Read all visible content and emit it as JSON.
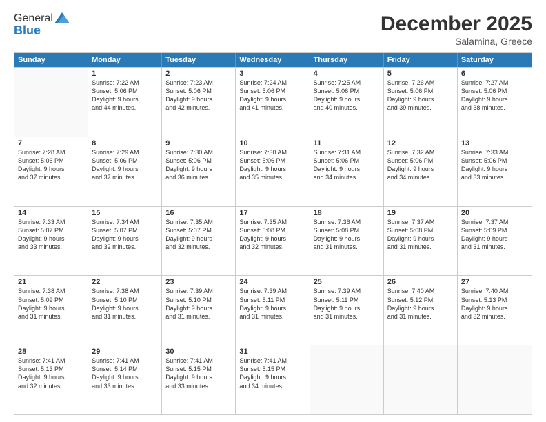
{
  "header": {
    "logo_general": "General",
    "logo_blue": "Blue",
    "month_title": "December 2025",
    "location": "Salamina, Greece"
  },
  "days_of_week": [
    "Sunday",
    "Monday",
    "Tuesday",
    "Wednesday",
    "Thursday",
    "Friday",
    "Saturday"
  ],
  "weeks": [
    [
      {
        "day": "",
        "lines": []
      },
      {
        "day": "1",
        "lines": [
          "Sunrise: 7:22 AM",
          "Sunset: 5:06 PM",
          "Daylight: 9 hours",
          "and 44 minutes."
        ]
      },
      {
        "day": "2",
        "lines": [
          "Sunrise: 7:23 AM",
          "Sunset: 5:06 PM",
          "Daylight: 9 hours",
          "and 42 minutes."
        ]
      },
      {
        "day": "3",
        "lines": [
          "Sunrise: 7:24 AM",
          "Sunset: 5:06 PM",
          "Daylight: 9 hours",
          "and 41 minutes."
        ]
      },
      {
        "day": "4",
        "lines": [
          "Sunrise: 7:25 AM",
          "Sunset: 5:06 PM",
          "Daylight: 9 hours",
          "and 40 minutes."
        ]
      },
      {
        "day": "5",
        "lines": [
          "Sunrise: 7:26 AM",
          "Sunset: 5:06 PM",
          "Daylight: 9 hours",
          "and 39 minutes."
        ]
      },
      {
        "day": "6",
        "lines": [
          "Sunrise: 7:27 AM",
          "Sunset: 5:06 PM",
          "Daylight: 9 hours",
          "and 38 minutes."
        ]
      }
    ],
    [
      {
        "day": "7",
        "lines": [
          "Sunrise: 7:28 AM",
          "Sunset: 5:06 PM",
          "Daylight: 9 hours",
          "and 37 minutes."
        ]
      },
      {
        "day": "8",
        "lines": [
          "Sunrise: 7:29 AM",
          "Sunset: 5:06 PM",
          "Daylight: 9 hours",
          "and 37 minutes."
        ]
      },
      {
        "day": "9",
        "lines": [
          "Sunrise: 7:30 AM",
          "Sunset: 5:06 PM",
          "Daylight: 9 hours",
          "and 36 minutes."
        ]
      },
      {
        "day": "10",
        "lines": [
          "Sunrise: 7:30 AM",
          "Sunset: 5:06 PM",
          "Daylight: 9 hours",
          "and 35 minutes."
        ]
      },
      {
        "day": "11",
        "lines": [
          "Sunrise: 7:31 AM",
          "Sunset: 5:06 PM",
          "Daylight: 9 hours",
          "and 34 minutes."
        ]
      },
      {
        "day": "12",
        "lines": [
          "Sunrise: 7:32 AM",
          "Sunset: 5:06 PM",
          "Daylight: 9 hours",
          "and 34 minutes."
        ]
      },
      {
        "day": "13",
        "lines": [
          "Sunrise: 7:33 AM",
          "Sunset: 5:06 PM",
          "Daylight: 9 hours",
          "and 33 minutes."
        ]
      }
    ],
    [
      {
        "day": "14",
        "lines": [
          "Sunrise: 7:33 AM",
          "Sunset: 5:07 PM",
          "Daylight: 9 hours",
          "and 33 minutes."
        ]
      },
      {
        "day": "15",
        "lines": [
          "Sunrise: 7:34 AM",
          "Sunset: 5:07 PM",
          "Daylight: 9 hours",
          "and 32 minutes."
        ]
      },
      {
        "day": "16",
        "lines": [
          "Sunrise: 7:35 AM",
          "Sunset: 5:07 PM",
          "Daylight: 9 hours",
          "and 32 minutes."
        ]
      },
      {
        "day": "17",
        "lines": [
          "Sunrise: 7:35 AM",
          "Sunset: 5:08 PM",
          "Daylight: 9 hours",
          "and 32 minutes."
        ]
      },
      {
        "day": "18",
        "lines": [
          "Sunrise: 7:36 AM",
          "Sunset: 5:08 PM",
          "Daylight: 9 hours",
          "and 31 minutes."
        ]
      },
      {
        "day": "19",
        "lines": [
          "Sunrise: 7:37 AM",
          "Sunset: 5:08 PM",
          "Daylight: 9 hours",
          "and 31 minutes."
        ]
      },
      {
        "day": "20",
        "lines": [
          "Sunrise: 7:37 AM",
          "Sunset: 5:09 PM",
          "Daylight: 9 hours",
          "and 31 minutes."
        ]
      }
    ],
    [
      {
        "day": "21",
        "lines": [
          "Sunrise: 7:38 AM",
          "Sunset: 5:09 PM",
          "Daylight: 9 hours",
          "and 31 minutes."
        ]
      },
      {
        "day": "22",
        "lines": [
          "Sunrise: 7:38 AM",
          "Sunset: 5:10 PM",
          "Daylight: 9 hours",
          "and 31 minutes."
        ]
      },
      {
        "day": "23",
        "lines": [
          "Sunrise: 7:39 AM",
          "Sunset: 5:10 PM",
          "Daylight: 9 hours",
          "and 31 minutes."
        ]
      },
      {
        "day": "24",
        "lines": [
          "Sunrise: 7:39 AM",
          "Sunset: 5:11 PM",
          "Daylight: 9 hours",
          "and 31 minutes."
        ]
      },
      {
        "day": "25",
        "lines": [
          "Sunrise: 7:39 AM",
          "Sunset: 5:11 PM",
          "Daylight: 9 hours",
          "and 31 minutes."
        ]
      },
      {
        "day": "26",
        "lines": [
          "Sunrise: 7:40 AM",
          "Sunset: 5:12 PM",
          "Daylight: 9 hours",
          "and 31 minutes."
        ]
      },
      {
        "day": "27",
        "lines": [
          "Sunrise: 7:40 AM",
          "Sunset: 5:13 PM",
          "Daylight: 9 hours",
          "and 32 minutes."
        ]
      }
    ],
    [
      {
        "day": "28",
        "lines": [
          "Sunrise: 7:41 AM",
          "Sunset: 5:13 PM",
          "Daylight: 9 hours",
          "and 32 minutes."
        ]
      },
      {
        "day": "29",
        "lines": [
          "Sunrise: 7:41 AM",
          "Sunset: 5:14 PM",
          "Daylight: 9 hours",
          "and 33 minutes."
        ]
      },
      {
        "day": "30",
        "lines": [
          "Sunrise: 7:41 AM",
          "Sunset: 5:15 PM",
          "Daylight: 9 hours",
          "and 33 minutes."
        ]
      },
      {
        "day": "31",
        "lines": [
          "Sunrise: 7:41 AM",
          "Sunset: 5:15 PM",
          "Daylight: 9 hours",
          "and 34 minutes."
        ]
      },
      {
        "day": "",
        "lines": []
      },
      {
        "day": "",
        "lines": []
      },
      {
        "day": "",
        "lines": []
      }
    ]
  ]
}
